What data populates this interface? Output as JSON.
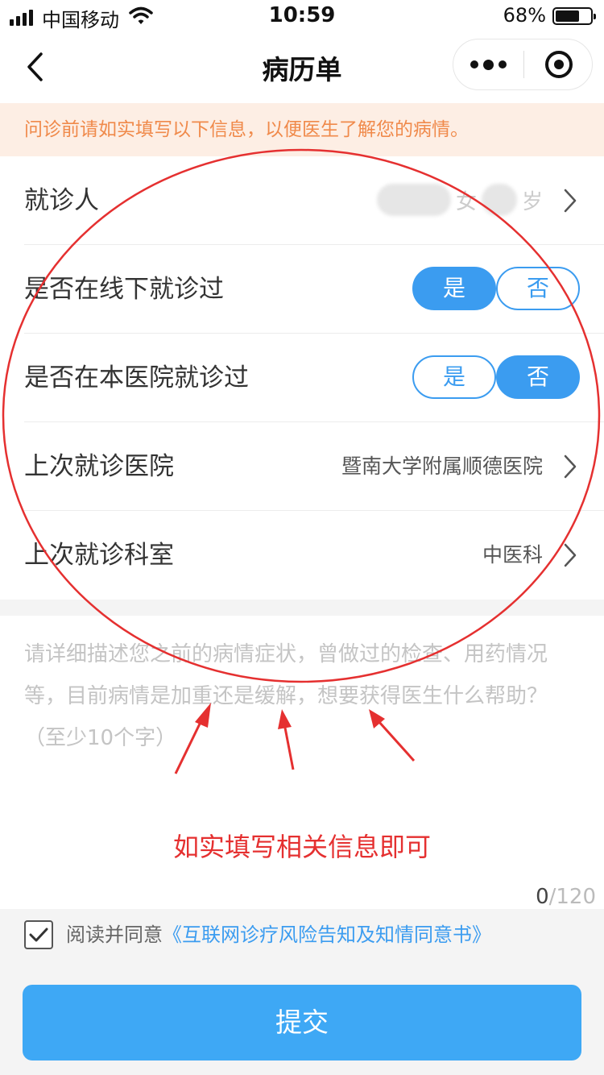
{
  "status_bar": {
    "carrier": "中国移动",
    "time": "10:59",
    "battery": "68%",
    "battery_level": 0.68,
    "icons": [
      "signal-icon",
      "wifi-icon",
      "battery-icon"
    ]
  },
  "nav": {
    "title": "病历单",
    "icons": [
      "back-icon",
      "more-icon",
      "close-icon"
    ]
  },
  "notice": "问诊前请如实填写以下信息，以便医生了解您的病情。",
  "form": {
    "patient": {
      "label": "就诊人",
      "gender": "女",
      "age_suffix": "岁"
    },
    "offline_visit": {
      "label": "是否在线下就诊过",
      "yes": "是",
      "no": "否",
      "selected": "是"
    },
    "this_hospital": {
      "label": "是否在本医院就诊过",
      "yes": "是",
      "no": "否",
      "selected": "否"
    },
    "last_hospital": {
      "label": "上次就诊医院",
      "value": "暨南大学附属顺德医院"
    },
    "last_department": {
      "label": "上次就诊科室",
      "value": "中医科"
    }
  },
  "description": {
    "placeholder": "请详细描述您之前的病情症状，曾做过的检查、用药情况等，目前病情是加重还是缓解，想要获得医生什么帮助？（至少10个字）",
    "counter_current": "0",
    "counter_max": "/120"
  },
  "annotation": "如实填写相关信息即可",
  "agreement": {
    "checked": true,
    "prefix": "阅读并同意",
    "link": "《互联网诊疗风险告知及知情同意书》"
  },
  "submit_label": "提交",
  "colors": {
    "accent": "#3b9cf0",
    "submit": "#3ea8f5",
    "notice_bg": "#fdeee4",
    "notice_text": "#f08a4b",
    "annotation_red": "#e53030"
  }
}
